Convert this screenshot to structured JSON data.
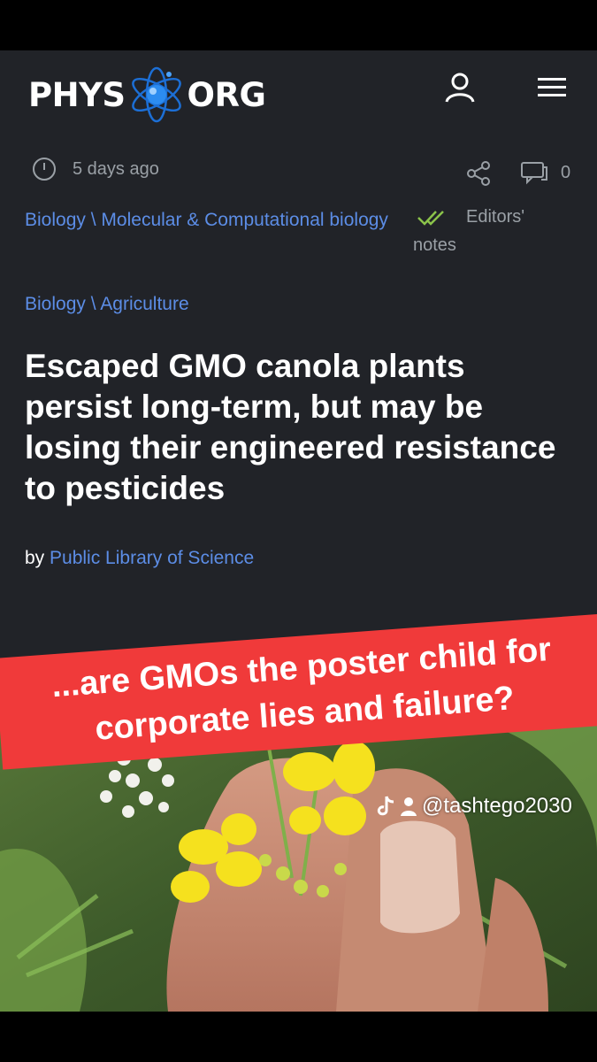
{
  "header": {
    "logo_left": "PHYS",
    "logo_right": "ORG"
  },
  "meta": {
    "time_ago": "5 days ago",
    "comment_count": "0",
    "editors_notes": "Editors' notes"
  },
  "categories": [
    {
      "section": "Biology",
      "separator": "\\",
      "topic": "Molecular & Computational biology"
    },
    {
      "section": "Biology",
      "separator": "\\",
      "topic": "Agriculture"
    }
  ],
  "article": {
    "headline": "Escaped GMO canola plants persist long-term, but may be losing their engineered resistance to pesticides",
    "by_prefix": "by",
    "author": "Public Library of Science"
  },
  "overlay": {
    "banner_text": "...are GMOs the poster child for corporate lies and failure?",
    "watermark": "@tashtego2030"
  },
  "colors": {
    "background": "#212328",
    "link": "#5c8de6",
    "banner": "#f03a3a",
    "editors_check": "#8bc34a"
  }
}
